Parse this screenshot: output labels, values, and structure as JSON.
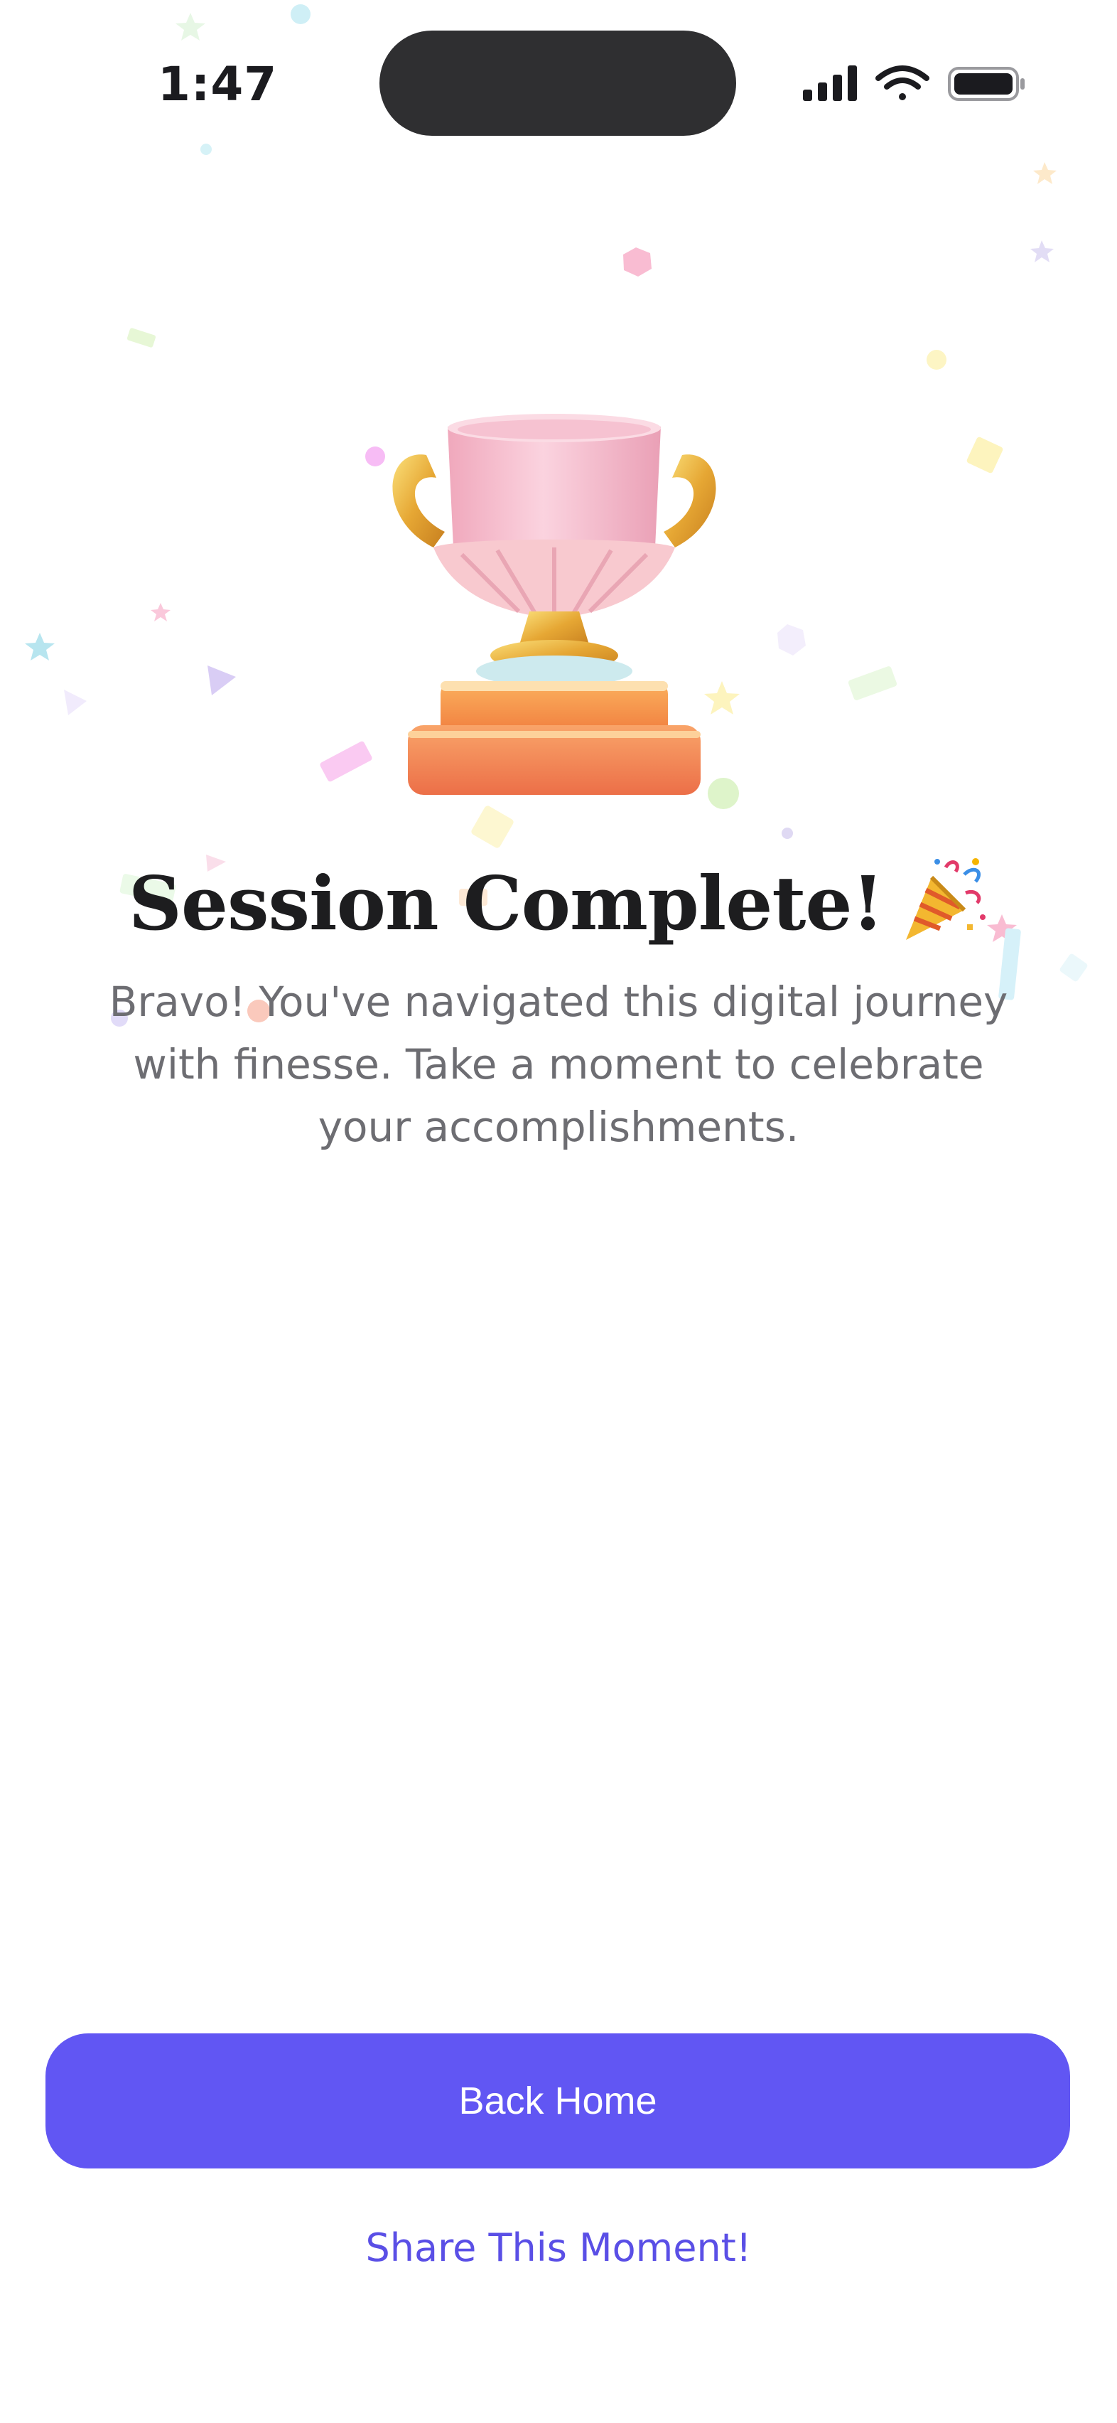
{
  "status_bar": {
    "time": "1:47",
    "icons": [
      "signal-icon",
      "wifi-icon",
      "battery-icon"
    ]
  },
  "hero": {
    "trophy_icon": "trophy-icon",
    "title": "Session Complete!",
    "title_emoji_icon": "party-popper-icon",
    "message": "Bravo! You've navigated this digital journey with finesse. Take a moment to celebrate your accomplishments."
  },
  "actions": {
    "primary_label": "Back Home",
    "secondary_label": "Share This Moment!"
  },
  "colors": {
    "accent": "#6156f3",
    "link": "#5a4fe6",
    "title": "#1d1d1f",
    "body_text": "#6d6d72"
  }
}
